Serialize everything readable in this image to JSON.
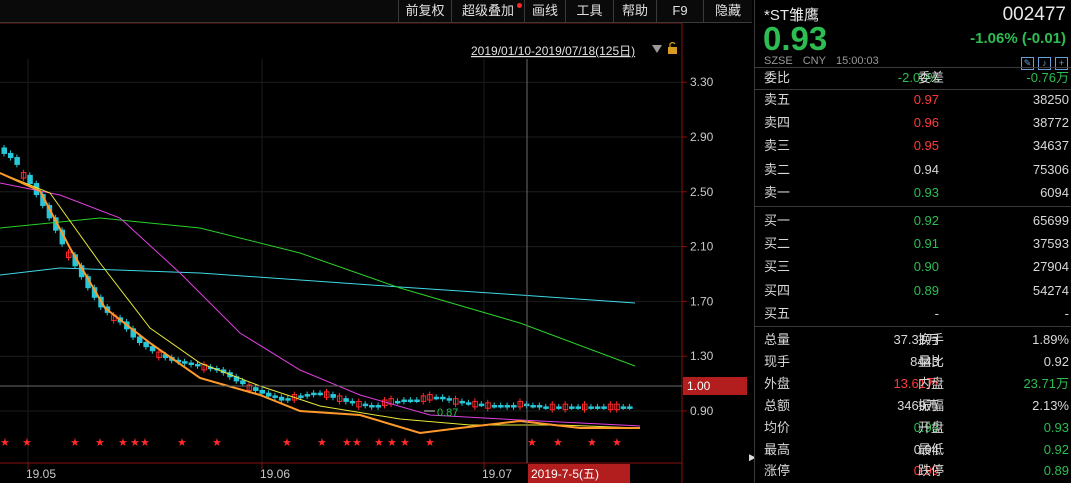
{
  "toolbar": {
    "buttons": [
      "前复权",
      "超级叠加",
      "画线",
      "工具",
      "帮助",
      "F9",
      "隐藏"
    ]
  },
  "chart": {
    "range_label": "2019/01/10-2019/07/18(125日)",
    "price_ticks": [
      "3.30",
      "2.90",
      "2.50",
      "2.10",
      "1.70",
      "1.30",
      "0.90"
    ],
    "crosshair_price": "1.00",
    "date_ticks": [
      "19.05",
      "19.06",
      "19.07"
    ],
    "crosshair_date": "2019-7-5(五)",
    "low_marker": "0.87",
    "colors": {
      "up": "#ff2a2a",
      "down": "#27c7d8",
      "ma5": "#ff9a2a",
      "ma10": "#e8e83a",
      "ma20": "#e040e0",
      "ma60": "#2ad02a",
      "ma120": "#40d8e8"
    }
  },
  "quote": {
    "name": "*ST雏鹰",
    "code": "002477",
    "price": "0.93",
    "change": "-1.06% (-0.01)",
    "exchange": "SZSE",
    "currency": "CNY",
    "time": "15:00:03",
    "weibi_label": "委比",
    "weibi": "-2.00%",
    "weicha_label": "委差",
    "weicha": "-0.76万",
    "asks": [
      {
        "label": "卖五",
        "price": "0.97",
        "vol": "38250",
        "color": "red"
      },
      {
        "label": "卖四",
        "price": "0.96",
        "vol": "38772",
        "color": "red"
      },
      {
        "label": "卖三",
        "price": "0.95",
        "vol": "34637",
        "color": "red"
      },
      {
        "label": "卖二",
        "price": "0.94",
        "vol": "75306",
        "color": "wht"
      },
      {
        "label": "卖一",
        "price": "0.93",
        "vol": "6094",
        "color": "green"
      }
    ],
    "bids": [
      {
        "label": "买一",
        "price": "0.92",
        "vol": "65699",
        "color": "green"
      },
      {
        "label": "买二",
        "price": "0.91",
        "vol": "37593",
        "color": "green"
      },
      {
        "label": "买三",
        "price": "0.90",
        "vol": "27904",
        "color": "green"
      },
      {
        "label": "买四",
        "price": "0.89",
        "vol": "54274",
        "color": "green"
      },
      {
        "label": "买五",
        "price": "-",
        "vol": "-",
        "color": "wht"
      }
    ],
    "stats": [
      {
        "l": "总量",
        "v1": "37.31万",
        "c1": "wht",
        "l2": "换手",
        "v2": "1.89%",
        "c2": "wht"
      },
      {
        "l": "现手",
        "v1": "8443",
        "c1": "wht",
        "l2": "量比",
        "v2": "0.92",
        "c2": "wht"
      },
      {
        "l": "外盘",
        "v1": "13.61万",
        "c1": "red",
        "l2": "内盘",
        "v2": "23.71万",
        "c2": "green"
      },
      {
        "l": "总额",
        "v1": "3469万",
        "c1": "wht",
        "l2": "振幅",
        "v2": "2.13%",
        "c2": "wht"
      },
      {
        "l": "均价",
        "v1": "0.93",
        "c1": "green",
        "l2": "开盘",
        "v2": "0.93",
        "c2": "green"
      },
      {
        "l": "最高",
        "v1": "0.94",
        "c1": "wht",
        "l2": "最低",
        "v2": "0.92",
        "c2": "green"
      },
      {
        "l": "涨停",
        "v1": "0.99",
        "c1": "red",
        "l2": "跌停",
        "v2": "0.89",
        "c2": "green"
      }
    ]
  }
}
